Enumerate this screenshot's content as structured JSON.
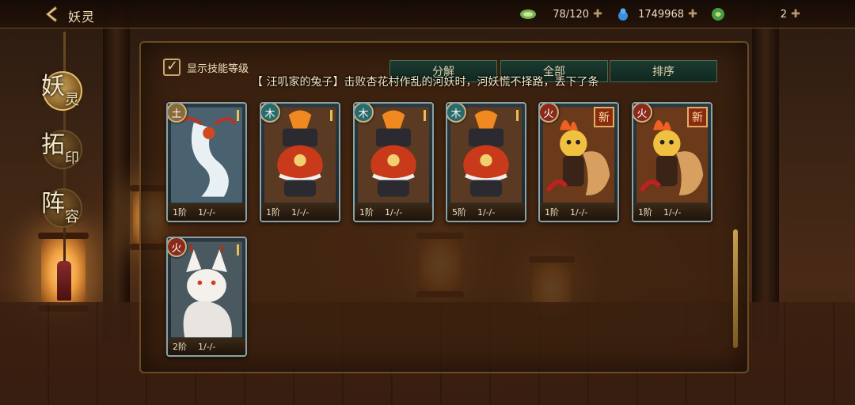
{
  "header": {
    "title": "妖灵",
    "resources": [
      {
        "icon": "jade-leaf-icon",
        "value": "78/120"
      },
      {
        "icon": "gourd-icon",
        "value": "1749968"
      },
      {
        "icon": "green-token-icon",
        "value": "2"
      }
    ]
  },
  "side_nav": [
    {
      "big": "妖",
      "small": "灵",
      "active": true
    },
    {
      "big": "拓",
      "small": "印",
      "active": false
    },
    {
      "big": "阵",
      "small": "容",
      "active": false
    }
  ],
  "toolbar": {
    "skill_toggle_label": "显示技能等级",
    "buttons": [
      "分解",
      "全部",
      "排序"
    ]
  },
  "marquee_text": "【 汪叽家的兔子】击败杏花村作乱的河妖时，河妖慌不择路，丢下了条",
  "cards": [
    {
      "element": "土",
      "element_color": "#8a6a3a",
      "rank": "1阶",
      "skills": "1/-/-",
      "new": false,
      "creature": "serpent"
    },
    {
      "element": "木",
      "element_color": "#2a6a6a",
      "rank": "1阶",
      "skills": "1/-/-",
      "new": false,
      "creature": "urn"
    },
    {
      "element": "木",
      "element_color": "#2a6a6a",
      "rank": "1阶",
      "skills": "1/-/-",
      "new": false,
      "creature": "urn"
    },
    {
      "element": "木",
      "element_color": "#2a6a6a",
      "rank": "5阶",
      "skills": "1/-/-",
      "new": false,
      "creature": "urn"
    },
    {
      "element": "火",
      "element_color": "#8a2a1a",
      "rank": "1阶",
      "skills": "1/-/-",
      "new": true,
      "new_label": "新",
      "creature": "fire"
    },
    {
      "element": "火",
      "element_color": "#8a2a1a",
      "rank": "1阶",
      "skills": "1/-/-",
      "new": true,
      "new_label": "新",
      "creature": "fire"
    },
    {
      "element": "火",
      "element_color": "#8a2a1a",
      "rank": "2阶",
      "skills": "1/-/-",
      "new": false,
      "creature": "fox"
    }
  ]
}
